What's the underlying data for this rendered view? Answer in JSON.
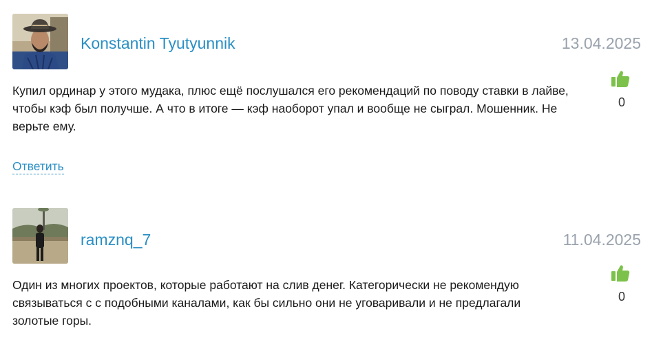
{
  "comments": [
    {
      "username": "Konstantin Tyutyunnik",
      "date": "13.04.2025",
      "text": "Купил ординар у этого мудака, плюс ещё послушался его рекомендаций по поводу ставки в лайве, чтобы кэф был получше. А что в итоге — кэф наоборот упал и вообще не сыграл. Мошенник. Не верьте ему.",
      "likes": "0",
      "reply_label": "Ответить",
      "like_icon": "thumbs-up-icon"
    },
    {
      "username": "ramznq_7",
      "date": "11.04.2025",
      "text": "Один из многих проектов, которые работают на слив денег. Категорически не рекомендую связываться с с подобными каналами, как бы сильно они не уговаривали и не предлагали золотые горы.",
      "likes": "0",
      "like_icon": "thumbs-up-icon"
    }
  ],
  "colors": {
    "username": "#2a8fc4",
    "date": "#9aa3ad",
    "like": "#7cc24a"
  }
}
